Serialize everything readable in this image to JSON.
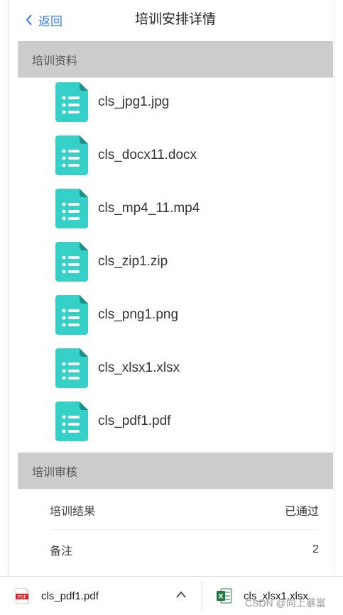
{
  "header": {
    "back_label": "返回",
    "title": "培训安排详情"
  },
  "sections": {
    "materials_title": "培训资料",
    "review_title": "培训审核"
  },
  "files": [
    {
      "name": "cls_jpg1.jpg"
    },
    {
      "name": "cls_docx11.docx"
    },
    {
      "name": "cls_mp4_11.mp4"
    },
    {
      "name": "cls_zip1.zip"
    },
    {
      "name": "cls_png1.png"
    },
    {
      "name": "cls_xlsx1.xlsx"
    },
    {
      "name": "cls_pdf1.pdf"
    }
  ],
  "review": {
    "result_label": "培训结果",
    "result_value": "已通过",
    "remark_label": "备注",
    "remark_value": "2"
  },
  "downloads": {
    "item1_name": "cls_pdf1.pdf",
    "item1_badge": "PDF",
    "item2_name": "cls_xlsx1.xlsx",
    "item2_badge": "X"
  },
  "watermark": "CSDN @向上暴富",
  "colors": {
    "accent": "#2f7ff0",
    "file_icon": "#35d0c8",
    "section_bg": "#cccccc"
  }
}
